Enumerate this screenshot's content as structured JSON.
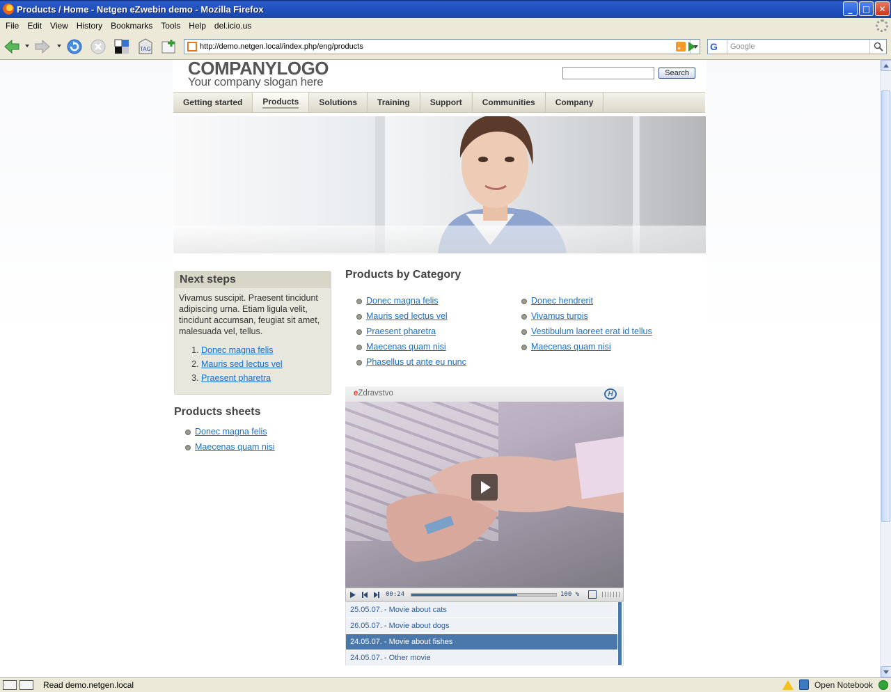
{
  "window": {
    "title": "Products / Home - Netgen eZwebin demo - Mozilla Firefox",
    "buttons": {
      "minimize": "_",
      "maximize": "□",
      "close": "✕"
    }
  },
  "menubar": {
    "items": [
      "File",
      "Edit",
      "View",
      "History",
      "Bookmarks",
      "Tools",
      "Help",
      "del.icio.us"
    ]
  },
  "toolbar": {
    "url": "http://demo.netgen.local/index.php/eng/products",
    "search_placeholder": "Google",
    "search_engine_label": "G",
    "tag_label": "TAG"
  },
  "site": {
    "logo_text": "COMPANYLOGO",
    "slogan": "Your company slogan here",
    "search_button": "Search",
    "search_value": "",
    "top_menu": [
      "Getting started",
      "Products",
      "Solutions",
      "Training",
      "Support",
      "Communities",
      "Company"
    ],
    "active_menu": "Products"
  },
  "next_steps": {
    "title": "Next steps",
    "text": "Vivamus suscipit. Praesent tincidunt adipiscing urna. Etiam ligula velit, tincidunt accumsan, feugiat sit amet, malesuada vel, tellus.",
    "items": [
      "Donec magna felis",
      "Mauris sed lectus vel",
      "Praesent pharetra"
    ]
  },
  "product_sheets": {
    "title": "Products sheets",
    "items": [
      "Donec magna felis",
      "Maecenas quam nisi"
    ]
  },
  "products_by_category": {
    "title": "Products by Category",
    "column_a": [
      "Donec magna felis",
      "Mauris sed lectus vel",
      "Praesent pharetra",
      "Maecenas quam nisi",
      "Phasellus ut ante eu nunc"
    ],
    "column_b": [
      "Donec hendrerit",
      "Vivamus turpis",
      "Vestibulum laoreet erat id tellus",
      "Maecenas quam nisi"
    ]
  },
  "video": {
    "brand_prefix": "e",
    "brand_name": "Zdravstvo",
    "badge": "H",
    "time": "00:24",
    "volume": "100 %",
    "progress": 0.73,
    "playlist": [
      {
        "label": "25.05.07. - Movie about cats",
        "selected": false
      },
      {
        "label": "26.05.07. - Movie about dogs",
        "selected": false
      },
      {
        "label": "24.05.07. - Movie about fishes",
        "selected": true
      },
      {
        "label": "24.05.07. - Other movie",
        "selected": false
      }
    ]
  },
  "statusbar": {
    "text": "Read demo.netgen.local",
    "notebook": "Open Notebook"
  }
}
